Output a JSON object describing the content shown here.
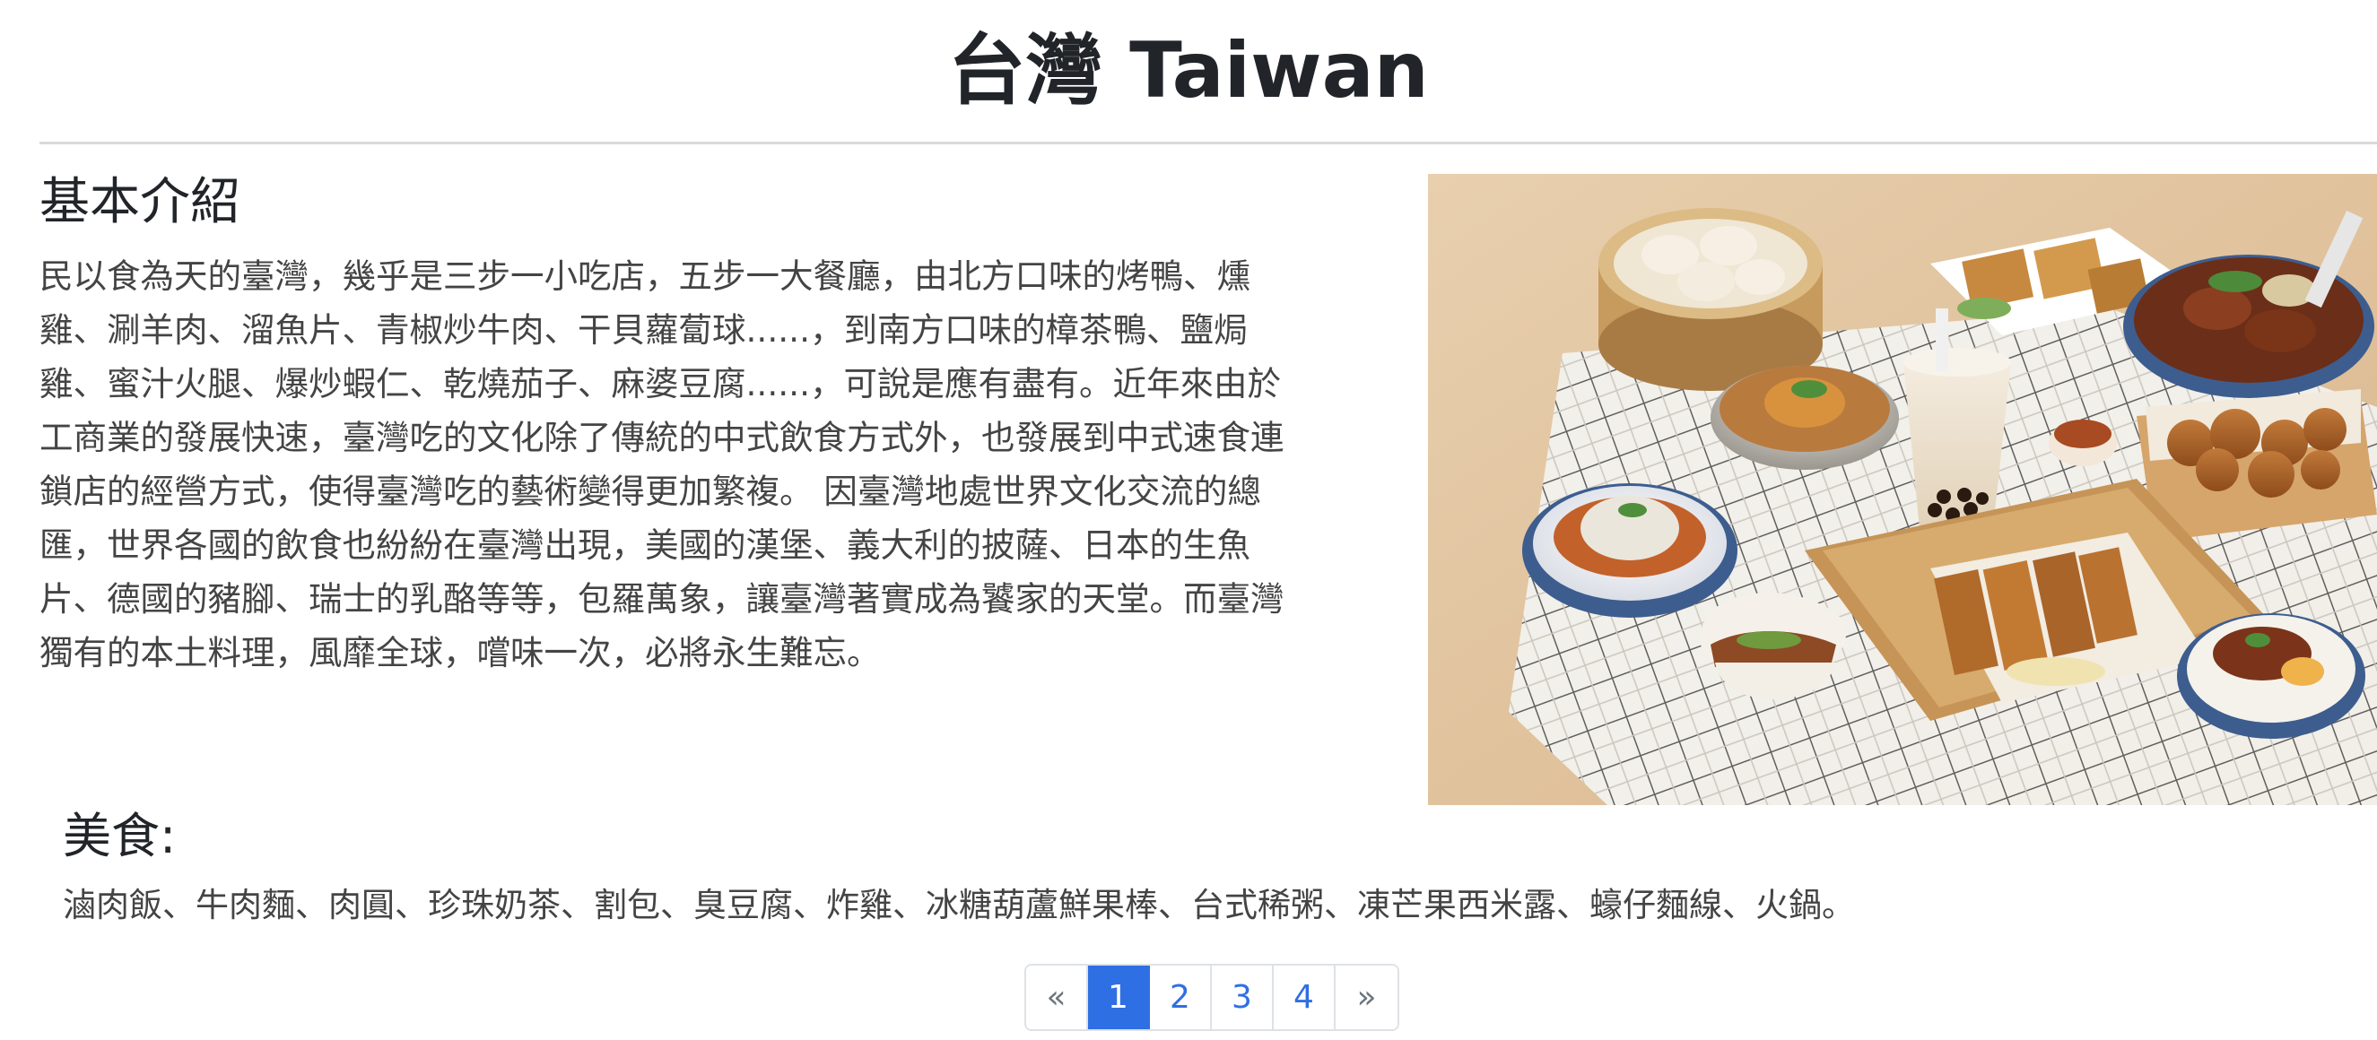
{
  "header": {
    "title": "台灣 Taiwan"
  },
  "intro": {
    "heading": "基本介紹",
    "text": "民以食為天的臺灣，幾乎是三步一小吃店，五步一大餐廳，由北方口味的烤鴨、燻\n雞、涮羊肉、溜魚片、青椒炒牛肉、干貝蘿蔔球......，到南方口味的樟茶鴨、鹽焗\n雞、蜜汁火腿、爆炒蝦仁、乾燒茄子、麻婆豆腐......，可說是應有盡有。近年來由於\n工商業的發展快速，臺灣吃的文化除了傳統的中式飲食方式外，也發展到中式速食連\n鎖店的經營方式，使得臺灣吃的藝術變得更加繁複。 因臺灣地處世界文化交流的總\n匯，世界各國的飲食也紛紛在臺灣出現，美國的漢堡、義大利的披薩、日本的生魚\n片、德國的豬腳、瑞士的乳酪等等，包羅萬象，讓臺灣著實成為饕家的天堂。而臺灣\n獨有的本土料理，風靡全球，嚐味一次，必將永生難忘。"
  },
  "food": {
    "heading": "美食:",
    "list": "滷肉飯、牛肉麵、肉圓、珍珠奶茶、割包、臭豆腐、炸雞、冰糖葫蘆鮮果棒、台式稀粥、凍芒果西米露、蠔仔麵線、火鍋。"
  },
  "pagination": {
    "prev": "«",
    "pages": [
      "1",
      "2",
      "3",
      "4"
    ],
    "active": "1",
    "next": "»"
  },
  "colors": {
    "accent": "#2f6fe4",
    "text": "#212529",
    "body_text": "#444444",
    "border": "#dee2e6"
  }
}
